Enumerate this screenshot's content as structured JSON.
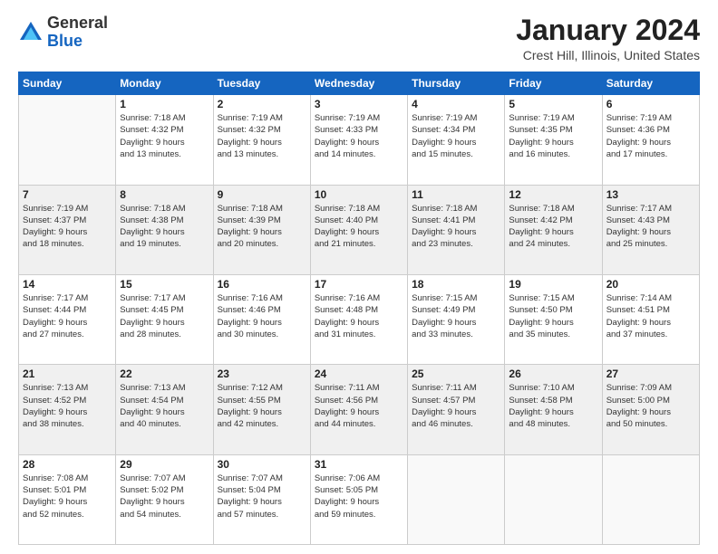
{
  "logo": {
    "general": "General",
    "blue": "Blue"
  },
  "title": "January 2024",
  "subtitle": "Crest Hill, Illinois, United States",
  "headers": [
    "Sunday",
    "Monday",
    "Tuesday",
    "Wednesday",
    "Thursday",
    "Friday",
    "Saturday"
  ],
  "weeks": [
    [
      {
        "num": "",
        "info": ""
      },
      {
        "num": "1",
        "info": "Sunrise: 7:18 AM\nSunset: 4:32 PM\nDaylight: 9 hours\nand 13 minutes."
      },
      {
        "num": "2",
        "info": "Sunrise: 7:19 AM\nSunset: 4:32 PM\nDaylight: 9 hours\nand 13 minutes."
      },
      {
        "num": "3",
        "info": "Sunrise: 7:19 AM\nSunset: 4:33 PM\nDaylight: 9 hours\nand 14 minutes."
      },
      {
        "num": "4",
        "info": "Sunrise: 7:19 AM\nSunset: 4:34 PM\nDaylight: 9 hours\nand 15 minutes."
      },
      {
        "num": "5",
        "info": "Sunrise: 7:19 AM\nSunset: 4:35 PM\nDaylight: 9 hours\nand 16 minutes."
      },
      {
        "num": "6",
        "info": "Sunrise: 7:19 AM\nSunset: 4:36 PM\nDaylight: 9 hours\nand 17 minutes."
      }
    ],
    [
      {
        "num": "7",
        "info": "Sunrise: 7:19 AM\nSunset: 4:37 PM\nDaylight: 9 hours\nand 18 minutes."
      },
      {
        "num": "8",
        "info": "Sunrise: 7:18 AM\nSunset: 4:38 PM\nDaylight: 9 hours\nand 19 minutes."
      },
      {
        "num": "9",
        "info": "Sunrise: 7:18 AM\nSunset: 4:39 PM\nDaylight: 9 hours\nand 20 minutes."
      },
      {
        "num": "10",
        "info": "Sunrise: 7:18 AM\nSunset: 4:40 PM\nDaylight: 9 hours\nand 21 minutes."
      },
      {
        "num": "11",
        "info": "Sunrise: 7:18 AM\nSunset: 4:41 PM\nDaylight: 9 hours\nand 23 minutes."
      },
      {
        "num": "12",
        "info": "Sunrise: 7:18 AM\nSunset: 4:42 PM\nDaylight: 9 hours\nand 24 minutes."
      },
      {
        "num": "13",
        "info": "Sunrise: 7:17 AM\nSunset: 4:43 PM\nDaylight: 9 hours\nand 25 minutes."
      }
    ],
    [
      {
        "num": "14",
        "info": "Sunrise: 7:17 AM\nSunset: 4:44 PM\nDaylight: 9 hours\nand 27 minutes."
      },
      {
        "num": "15",
        "info": "Sunrise: 7:17 AM\nSunset: 4:45 PM\nDaylight: 9 hours\nand 28 minutes."
      },
      {
        "num": "16",
        "info": "Sunrise: 7:16 AM\nSunset: 4:46 PM\nDaylight: 9 hours\nand 30 minutes."
      },
      {
        "num": "17",
        "info": "Sunrise: 7:16 AM\nSunset: 4:48 PM\nDaylight: 9 hours\nand 31 minutes."
      },
      {
        "num": "18",
        "info": "Sunrise: 7:15 AM\nSunset: 4:49 PM\nDaylight: 9 hours\nand 33 minutes."
      },
      {
        "num": "19",
        "info": "Sunrise: 7:15 AM\nSunset: 4:50 PM\nDaylight: 9 hours\nand 35 minutes."
      },
      {
        "num": "20",
        "info": "Sunrise: 7:14 AM\nSunset: 4:51 PM\nDaylight: 9 hours\nand 37 minutes."
      }
    ],
    [
      {
        "num": "21",
        "info": "Sunrise: 7:13 AM\nSunset: 4:52 PM\nDaylight: 9 hours\nand 38 minutes."
      },
      {
        "num": "22",
        "info": "Sunrise: 7:13 AM\nSunset: 4:54 PM\nDaylight: 9 hours\nand 40 minutes."
      },
      {
        "num": "23",
        "info": "Sunrise: 7:12 AM\nSunset: 4:55 PM\nDaylight: 9 hours\nand 42 minutes."
      },
      {
        "num": "24",
        "info": "Sunrise: 7:11 AM\nSunset: 4:56 PM\nDaylight: 9 hours\nand 44 minutes."
      },
      {
        "num": "25",
        "info": "Sunrise: 7:11 AM\nSunset: 4:57 PM\nDaylight: 9 hours\nand 46 minutes."
      },
      {
        "num": "26",
        "info": "Sunrise: 7:10 AM\nSunset: 4:58 PM\nDaylight: 9 hours\nand 48 minutes."
      },
      {
        "num": "27",
        "info": "Sunrise: 7:09 AM\nSunset: 5:00 PM\nDaylight: 9 hours\nand 50 minutes."
      }
    ],
    [
      {
        "num": "28",
        "info": "Sunrise: 7:08 AM\nSunset: 5:01 PM\nDaylight: 9 hours\nand 52 minutes."
      },
      {
        "num": "29",
        "info": "Sunrise: 7:07 AM\nSunset: 5:02 PM\nDaylight: 9 hours\nand 54 minutes."
      },
      {
        "num": "30",
        "info": "Sunrise: 7:07 AM\nSunset: 5:04 PM\nDaylight: 9 hours\nand 57 minutes."
      },
      {
        "num": "31",
        "info": "Sunrise: 7:06 AM\nSunset: 5:05 PM\nDaylight: 9 hours\nand 59 minutes."
      },
      {
        "num": "",
        "info": ""
      },
      {
        "num": "",
        "info": ""
      },
      {
        "num": "",
        "info": ""
      }
    ]
  ]
}
